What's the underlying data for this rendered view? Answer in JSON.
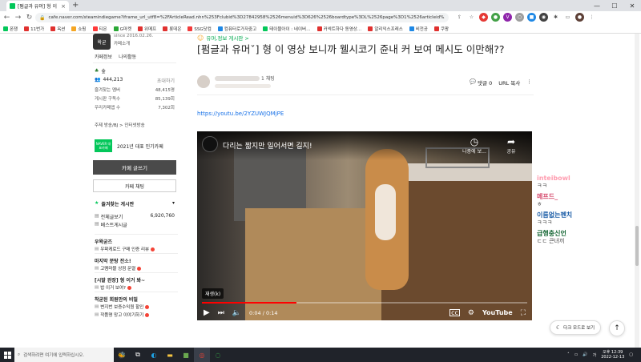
{
  "browser": {
    "tab_title": "[펌글과 유머] 형 이 영상…",
    "new_tab": "+",
    "url": "cafe.naver.com/steamindiegame?iframe_url_utf8=%2FArticleRead.nhn%253Fclubid%3D27842958%2526menuid%3D626%2526boardtype%3DL%2526page%3D1%2526articleid%3D8826715",
    "bookmarks": [
      {
        "label": "폰쟁",
        "color": "#03c75a"
      },
      {
        "label": "11번가",
        "color": "#e0312f"
      },
      {
        "label": "옥션",
        "color": "#e0312f"
      },
      {
        "label": "쇼핑",
        "color": "#f5a623"
      },
      {
        "label": "티몬",
        "color": "#ff3a3a"
      },
      {
        "label": "G마켓",
        "color": "#2aa836"
      },
      {
        "label": "위메프",
        "color": "#e0312f"
      },
      {
        "label": "롯데온",
        "color": "#e0312f"
      },
      {
        "label": "SSG닷컴",
        "color": "#f23a3a"
      },
      {
        "label": "컴퓨터로가자중고",
        "color": "#1e88e5"
      },
      {
        "label": "테이블아이 : 네이버…",
        "color": "#03c75a"
      },
      {
        "label": "커넥트하다 동영상…",
        "color": "#e0312f"
      },
      {
        "label": "알리익스프레스",
        "color": "#e0312f"
      },
      {
        "label": "비전공",
        "color": "#1e88e5"
      },
      {
        "label": "쿠팡",
        "color": "#e0312f"
      }
    ]
  },
  "left": {
    "since": "since 2016.02.26.",
    "cafe_intro": "카페소개",
    "tabs": [
      "카페정보",
      "나의활동"
    ],
    "member_level": "숲",
    "member_count": "444,213",
    "invite": "초대하기",
    "stats": [
      {
        "label": "즐겨찾는 멤버",
        "value": "48,415명"
      },
      {
        "label": "게시판 구독수",
        "value": "85,139회"
      },
      {
        "label": "우리카페앱 수",
        "value": "7,302회"
      }
    ],
    "topics": "주제  방송/BJ > 인터넷방송",
    "naver_badge": "NAVER 대표카페",
    "award": "2021년 대표 인기카페",
    "write_button": "카페 글쓰기",
    "chat_button": "카페 채팅",
    "favorite_board": "즐겨찾는 게시판",
    "boards": [
      {
        "label": "전체글보기",
        "count": "6,920,760"
      },
      {
        "label": "베스트게시글",
        "count": ""
      }
    ],
    "sections": [
      {
        "title": "우왁굳즈",
        "items": [
          "우왁케로드 구매 인증 리뷰"
        ]
      },
      {
        "title": "마지막 분탕 잔소!",
        "items": [
          "고멤마블 상점 문열"
        ]
      },
      {
        "title": "[시발 완장] 형 이거 봐~",
        "items": [
          "밥 이거 보여?"
        ]
      },
      {
        "title": "착굳된 회원만의 비밀",
        "items": [
          "변지번 보증수익원 할인",
          "작품명 망고 이야기하기"
        ]
      }
    ]
  },
  "article": {
    "category": "유머,정보 게시판 >",
    "title": "[펌글과 유머ˇ] 형 이 영상 보니까 웰시코기 쥰내 커 보여 메시도 이만해??",
    "author_level": "1 채팅",
    "comments": "댓글 0",
    "url_copy": "URL 복사",
    "link": "https://youtu.be/2YZUWJQMjPE",
    "video": {
      "title": "다리는 짧지만 일어서면 길지!",
      "later": "나중에 보...",
      "share": "공유",
      "replay_badge": "재생(k)",
      "time": "0:04 / 0:14",
      "progress": 0.29,
      "youtube": "YouTube"
    }
  },
  "chat": [
    {
      "name": "inteibowl",
      "msg": "ㅋㅋ",
      "color": "#ff9db0"
    },
    {
      "name": "메프드_",
      "msg": "ㅎ",
      "color": "#d64b6e"
    },
    {
      "name": "이름없는펜치",
      "msg": "ㅋㅋㅋ",
      "color": "#1e5fa8"
    },
    {
      "name": "급행충신언",
      "msg": "ㄷㄷ 큰녀끼",
      "color": "#1c6b3a"
    }
  ],
  "floating": {
    "dark_mode": "다크 모드로 보기"
  },
  "taskbar": {
    "search_placeholder": "검색하려면 여기에 입력하십시오.",
    "time": "오후 12:39",
    "date": "2022-12-13"
  }
}
